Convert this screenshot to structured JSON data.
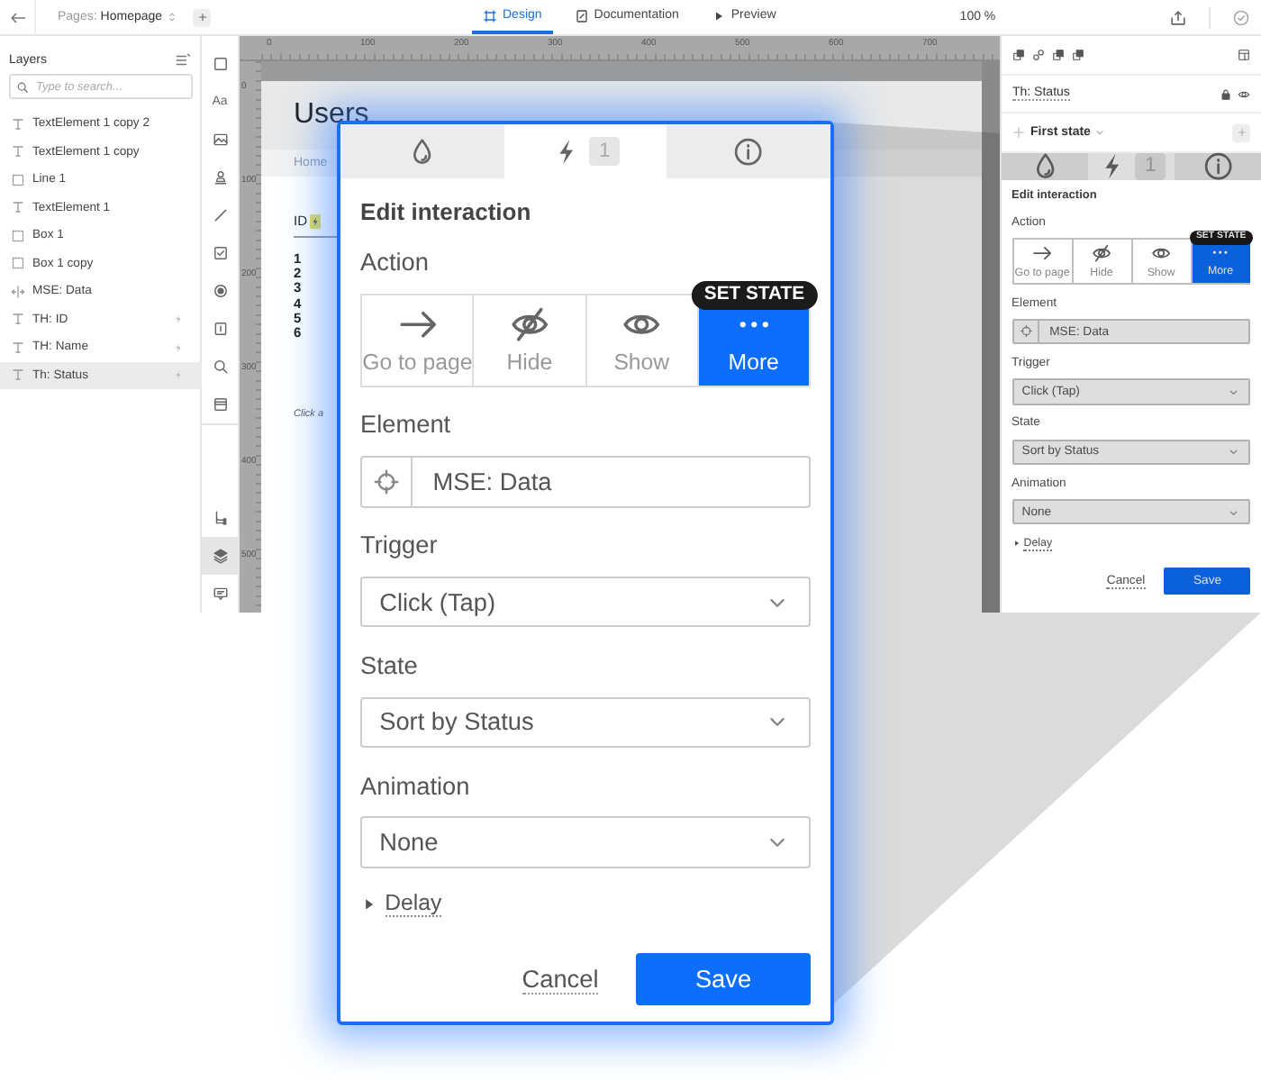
{
  "toolbar": {
    "pages_label": "Pages:",
    "page": "Homepage",
    "tabs": [
      {
        "label": "Design",
        "kind": "design",
        "selected": true
      },
      {
        "label": "Documentation",
        "kind": "doc",
        "selected": false
      },
      {
        "label": "Preview",
        "kind": "preview",
        "selected": false
      }
    ],
    "zoom": "100 %"
  },
  "layers": {
    "title": "Layers",
    "search_placeholder": "Type to search...",
    "items": [
      {
        "name": "TextElement 1 copy 2",
        "kind": "text",
        "interaction": false,
        "selected": false
      },
      {
        "name": "TextElement 1 copy",
        "kind": "text",
        "interaction": false,
        "selected": false
      },
      {
        "name": "Line 1",
        "kind": "box",
        "interaction": false,
        "selected": false
      },
      {
        "name": "TextElement 1",
        "kind": "text",
        "interaction": false,
        "selected": false
      },
      {
        "name": "Box 1",
        "kind": "box",
        "interaction": false,
        "selected": false
      },
      {
        "name": "Box 1 copy",
        "kind": "box",
        "interaction": false,
        "selected": false
      },
      {
        "name": "MSE: Data",
        "kind": "states",
        "interaction": false,
        "selected": false
      },
      {
        "name": "TH: ID",
        "kind": "text",
        "interaction": true,
        "selected": false
      },
      {
        "name": "TH: Name",
        "kind": "text",
        "interaction": true,
        "selected": false
      },
      {
        "name": "Th: Status",
        "kind": "text",
        "interaction": true,
        "selected": true
      }
    ]
  },
  "tools": [
    {
      "kind": "rectangle",
      "selected": false
    },
    {
      "kind": "text",
      "glyph": "Aa",
      "selected": false
    },
    {
      "kind": "image",
      "selected": false
    },
    {
      "kind": "stamp",
      "selected": false
    },
    {
      "kind": "line",
      "selected": false
    },
    {
      "kind": "checkbox",
      "selected": false
    },
    {
      "kind": "radio",
      "selected": false
    },
    {
      "kind": "input",
      "selected": false
    },
    {
      "kind": "search",
      "selected": false
    },
    {
      "kind": "table",
      "selected": false
    }
  ],
  "panel_tools": [
    {
      "kind": "flow",
      "selected": false
    },
    {
      "kind": "layers",
      "selected": true
    },
    {
      "kind": "comments",
      "selected": false
    }
  ],
  "canvas": {
    "hruler": [
      "0",
      "100",
      "200",
      "300",
      "400",
      "500",
      "600",
      "700"
    ],
    "vruler": [
      "0",
      "100",
      "200",
      "300",
      "400",
      "500"
    ],
    "page": {
      "title": "Users",
      "breadcrumb": "Home",
      "column": "ID",
      "rows": [
        "1",
        "2",
        "3",
        "4",
        "5",
        "6"
      ],
      "hint": "Click a"
    }
  },
  "inspector": {
    "element_name": "Th: Status",
    "state": "First state",
    "interaction": {
      "tabs": [
        {
          "kind": "style",
          "selected": false
        },
        {
          "kind": "interactions",
          "badge": "1",
          "selected": true
        },
        {
          "kind": "info",
          "selected": false
        }
      ],
      "title": "Edit interaction",
      "action_label": "Action",
      "actions": [
        {
          "label": "Go to page",
          "kind": "goto",
          "selected": false
        },
        {
          "label": "Hide",
          "kind": "hide",
          "selected": false
        },
        {
          "label": "Show",
          "kind": "show",
          "selected": false
        },
        {
          "label": "More",
          "kind": "more",
          "tooltip": "SET STATE",
          "selected": true
        }
      ],
      "element_label": "Element",
      "element": "MSE: Data",
      "trigger_label": "Trigger",
      "trigger": "Click (Tap)",
      "state_label": "State",
      "state": "Sort by Status",
      "animation_label": "Animation",
      "animation": "None",
      "delay": {
        "label": "Delay",
        "expanded": false
      },
      "cancel": "Cancel",
      "save": "Save"
    }
  },
  "zoomed_interaction": {
    "tabs": [
      {
        "kind": "style",
        "selected": false
      },
      {
        "kind": "interactions",
        "badge": "1",
        "selected": true
      },
      {
        "kind": "info",
        "selected": false
      }
    ],
    "title": "Edit interaction",
    "action_label": "Action",
    "actions": [
      {
        "label": "Go to page",
        "kind": "goto",
        "selected": false
      },
      {
        "label": "Hide",
        "kind": "hide",
        "selected": false
      },
      {
        "label": "Show",
        "kind": "show",
        "selected": false
      },
      {
        "label": "More",
        "kind": "more",
        "tooltip": "SET STATE",
        "selected": true
      }
    ],
    "element_label": "Element",
    "element": "MSE: Data",
    "trigger_label": "Trigger",
    "trigger": "Click (Tap)",
    "state_label": "State",
    "state": "Sort by Status",
    "animation_label": "Animation",
    "animation": "None",
    "delay": {
      "label": "Delay",
      "expanded": false
    },
    "cancel": "Cancel",
    "save": "Save"
  }
}
